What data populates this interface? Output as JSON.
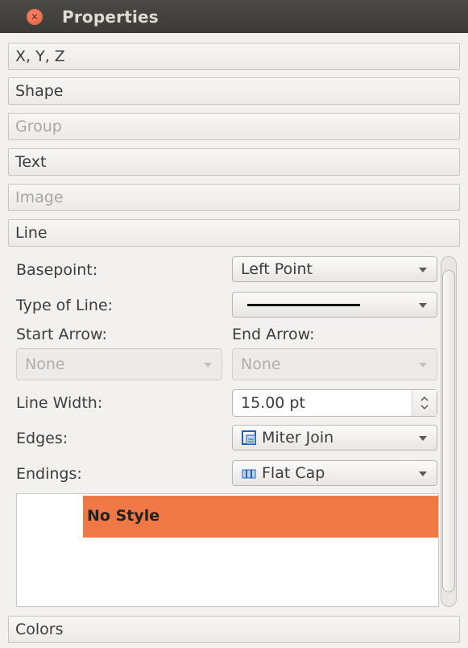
{
  "window": {
    "title": "Properties"
  },
  "sections": [
    {
      "label": "X, Y, Z",
      "disabled": false
    },
    {
      "label": "Shape",
      "disabled": false
    },
    {
      "label": "Group",
      "disabled": true
    },
    {
      "label": "Text",
      "disabled": false
    },
    {
      "label": "Image",
      "disabled": true
    },
    {
      "label": "Line",
      "disabled": false
    },
    {
      "label": "Colors",
      "disabled": false
    }
  ],
  "line": {
    "basepoint_label": "Basepoint:",
    "basepoint_value": "Left Point",
    "type_of_line_label": "Type of Line:",
    "start_arrow_label": "Start Arrow:",
    "end_arrow_label": "End Arrow:",
    "start_arrow_value": "None",
    "end_arrow_value": "None",
    "line_width_label": "Line Width:",
    "line_width_value": "15.00 pt",
    "edges_label": "Edges:",
    "edges_value": "Miter Join",
    "endings_label": "Endings:",
    "endings_value": "Flat Cap"
  },
  "style_list": {
    "items": [
      "No Style"
    ],
    "selected": 0
  },
  "colors": {
    "accent": "#f07846",
    "titlebar": "#3c3b37",
    "close": "#e35b35"
  },
  "icons": {
    "close": "close-icon",
    "edges": "miter-join-icon",
    "endings": "flat-cap-icon"
  }
}
